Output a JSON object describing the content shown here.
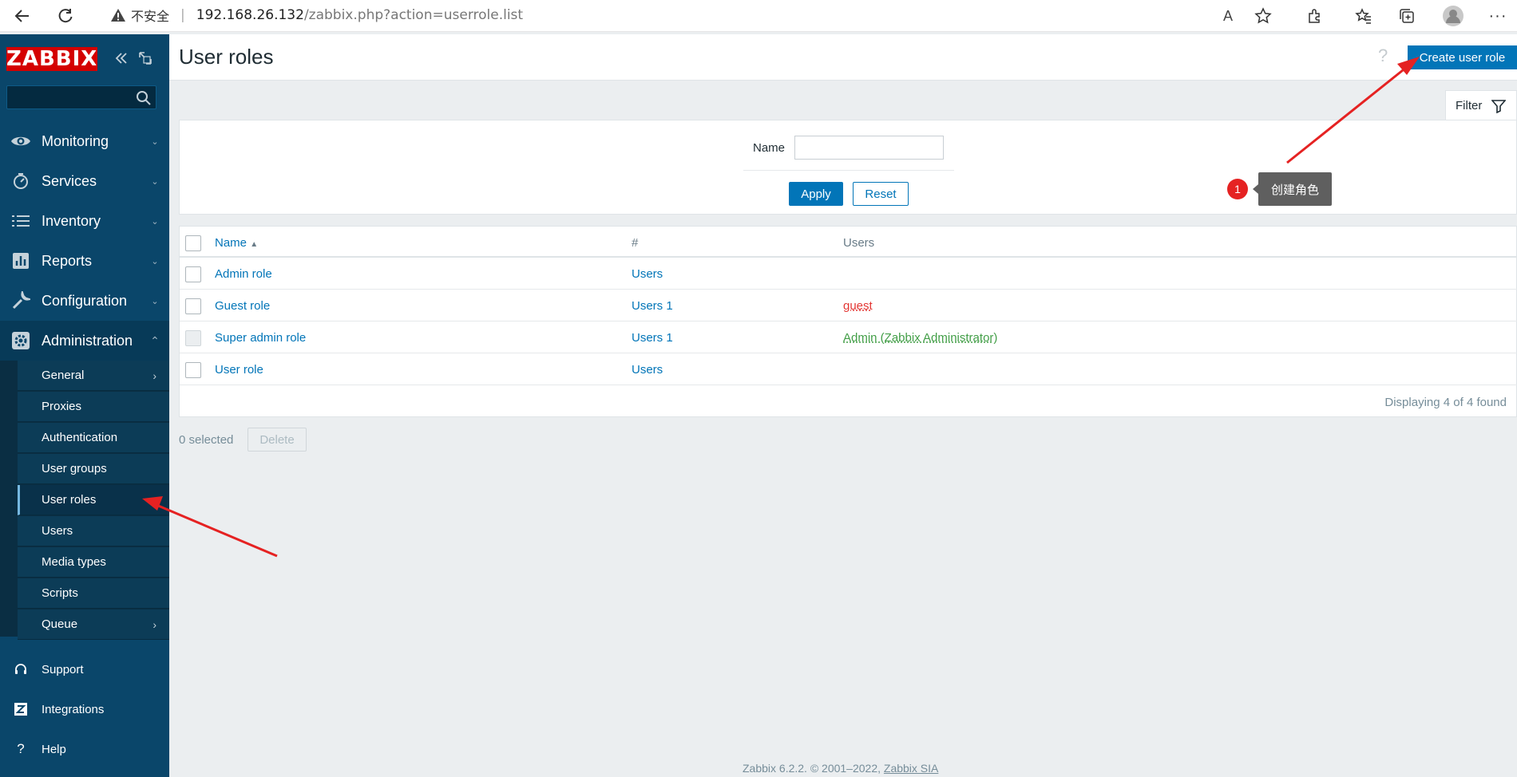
{
  "browser": {
    "security_label": "不安全",
    "url_host": "192.168.26.132",
    "url_path": "/zabbix.php?action=userrole.list"
  },
  "sidebar": {
    "logo": "ZABBIX",
    "search_placeholder": "",
    "menu": [
      {
        "label": "Monitoring",
        "icon": "eye-icon"
      },
      {
        "label": "Services",
        "icon": "stopwatch-icon"
      },
      {
        "label": "Inventory",
        "icon": "list-icon"
      },
      {
        "label": "Reports",
        "icon": "bar-chart-icon"
      },
      {
        "label": "Configuration",
        "icon": "wrench-icon"
      },
      {
        "label": "Administration",
        "icon": "gear-icon"
      }
    ],
    "admin_submenu": [
      "General",
      "Proxies",
      "Authentication",
      "User groups",
      "User roles",
      "Users",
      "Media types",
      "Scripts",
      "Queue"
    ],
    "selected_submenu": "User roles",
    "bottom": [
      {
        "label": "Support",
        "icon": "headset-icon"
      },
      {
        "label": "Integrations",
        "icon": "zabbix-z-icon"
      },
      {
        "label": "Help",
        "icon": "question-icon"
      }
    ]
  },
  "header": {
    "title": "User roles",
    "help": "?",
    "create_button": "Create user role"
  },
  "filter": {
    "tab_label": "Filter",
    "name_label": "Name",
    "name_value": "",
    "apply": "Apply",
    "reset": "Reset"
  },
  "annotation": {
    "number": "1",
    "text": "创建角色",
    "arrow_color": "#e52222"
  },
  "table": {
    "headers": {
      "name": "Name",
      "sort_indicator": "▲",
      "count": "#",
      "users": "Users"
    },
    "rows": [
      {
        "name": "Admin role",
        "count": "Users",
        "users": ""
      },
      {
        "name": "Guest role",
        "count": "Users 1",
        "users": "guest"
      },
      {
        "name": "Super admin role",
        "count": "Users 1",
        "users": "Admin (Zabbix Administrator)"
      },
      {
        "name": "User role",
        "count": "Users",
        "users": ""
      }
    ],
    "displaying": "Displaying 4 of 4 found"
  },
  "actions": {
    "selected": "0 selected",
    "delete": "Delete"
  },
  "footer": {
    "text": "Zabbix 6.2.2. © 2001–2022,",
    "link": "Zabbix SIA"
  },
  "colors": {
    "sidebar_bg": "#0a466a",
    "accent": "#0275b8",
    "logo": "#d40000",
    "user_red": "#e33734",
    "user_green": "#429e47"
  }
}
